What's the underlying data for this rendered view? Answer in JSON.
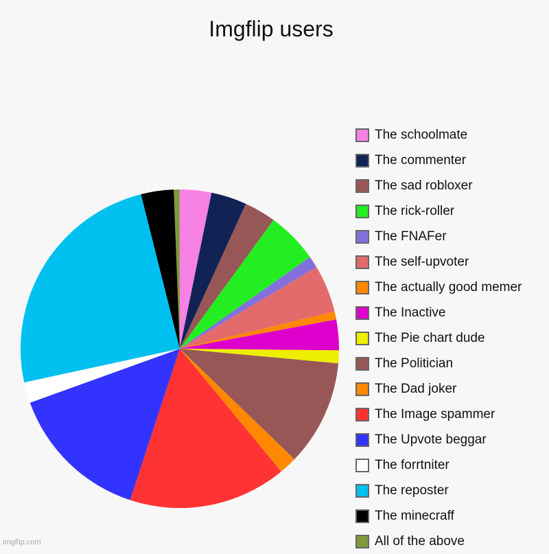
{
  "chart_data": {
    "type": "pie",
    "title": "Imgflip users",
    "start_angle_deg": -2.2,
    "direction": "clockwise",
    "legend_position": "right",
    "slices": [
      {
        "label": "The schoolmate",
        "value": 3.2,
        "color": "#f781e4"
      },
      {
        "label": "The commenter",
        "value": 3.6,
        "color": "#112255"
      },
      {
        "label": "The sad robloxer",
        "value": 3.2,
        "color": "#985757"
      },
      {
        "label": "The rick-roller",
        "value": 5.2,
        "color": "#22ee22"
      },
      {
        "label": "The FNAFer",
        "value": 1.2,
        "color": "#8470dd"
      },
      {
        "label": "The self-upvoter",
        "value": 4.8,
        "color": "#e36b6b"
      },
      {
        "label": "The actually good memer",
        "value": 0.8,
        "color": "#ff8800"
      },
      {
        "label": "The Inactive",
        "value": 3.1,
        "color": "#dd00cc"
      },
      {
        "label": "The Pie chart dude",
        "value": 1.3,
        "color": "#eeee00"
      },
      {
        "label": "The Politician",
        "value": 10.7,
        "color": "#985757"
      },
      {
        "label": "The Dad joker",
        "value": 1.8,
        "color": "#ff8800"
      },
      {
        "label": "The Image spammer",
        "value": 16.0,
        "color": "#ff3333"
      },
      {
        "label": "The Upvote beggar",
        "value": 14.4,
        "color": "#3333ff"
      },
      {
        "label": "The forrtniter",
        "value": 2.1,
        "color": "#ffffff"
      },
      {
        "label": "The reposter",
        "value": 24.4,
        "color": "#00c0f0"
      },
      {
        "label": "The minecraff",
        "value": 3.3,
        "color": "#000000"
      },
      {
        "label": "All of the above",
        "value": 0.6,
        "color": "#7f9a3a"
      }
    ]
  },
  "watermark": "imgflip.com"
}
